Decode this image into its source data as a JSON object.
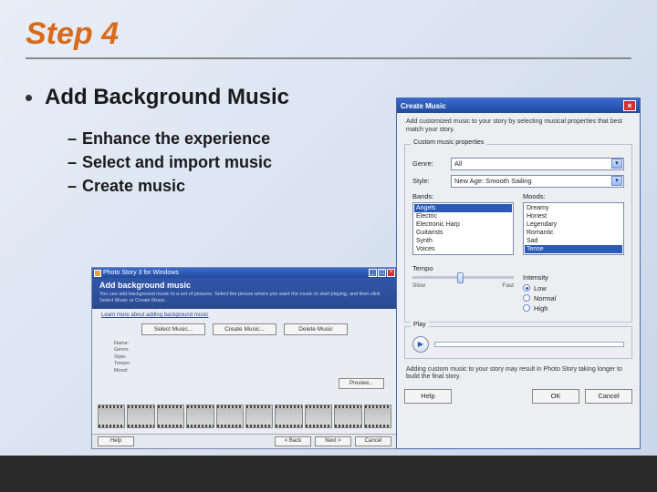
{
  "slide": {
    "title": "Step 4",
    "bullet": "Add Background Music",
    "sub1": "Enhance the experience",
    "sub2": "Select and import music",
    "sub3": "Create music"
  },
  "wizard": {
    "title": "Photo Story 3 for Windows",
    "heading": "Add background music",
    "desc": "You can add background music to a set of pictures. Select the picture where you want the music to start playing, and then click Select Music or Create Music.",
    "learn": "Learn more about adding background music",
    "btn_select": "Select Music...",
    "btn_create": "Create Music...",
    "btn_delete": "Delete Music",
    "info1": "Name:",
    "info2": "Genre:",
    "info3": "Style:",
    "info4": "Tempo:",
    "info5": "Mood:",
    "preview": "Preview...",
    "nav_help": "Help",
    "nav_back": "< Back",
    "nav_next": "Next >",
    "nav_cancel": "Cancel"
  },
  "dialog": {
    "title": "Create Music",
    "desc": "Add customized music to your story by selecting musical properties that best match your story.",
    "group_label": "Custom music properties",
    "genre_label": "Genre:",
    "genre_value": "All",
    "style_label": "Style:",
    "style_value": "New Age: Smooth Sailing",
    "bands_label": "Bands:",
    "moods_label": "Moods:",
    "bands": [
      "Angels",
      "Electric",
      "Electronic Harp",
      "Guitarists",
      "Synth",
      "Voices"
    ],
    "moods": [
      "Dreamy",
      "Honest",
      "Legendary",
      "Romantic",
      "Sad",
      "Tense"
    ],
    "bands_selected": "Angels",
    "moods_selected": "Tense",
    "tempo_label": "Tempo",
    "tempo_slow": "Slow",
    "tempo_fast": "Fast",
    "intensity_label": "Intensity",
    "intensity_low": "Low",
    "intensity_normal": "Normal",
    "intensity_high": "High",
    "play_label": "Play",
    "note": "Adding custom music to your story may result in Photo Story taking longer to build the final story.",
    "btn_help": "Help",
    "btn_ok": "OK",
    "btn_cancel": "Cancel"
  }
}
